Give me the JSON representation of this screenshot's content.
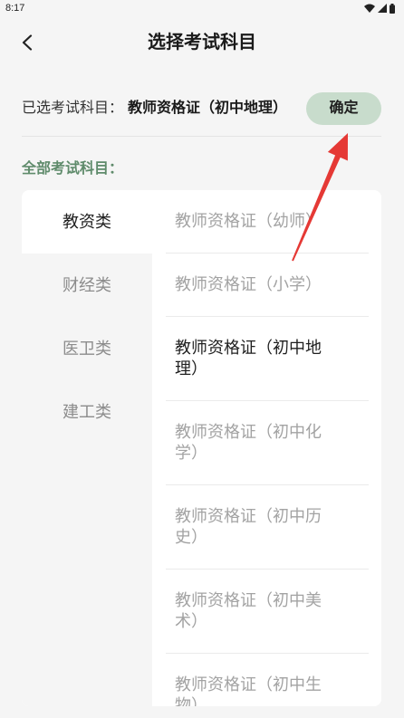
{
  "status_bar": {
    "time": "8:17",
    "icons": [
      "wifi-icon",
      "signal-icon",
      "battery-icon"
    ]
  },
  "header": {
    "back_icon": "chevron-left-icon",
    "title": "选择考试科目"
  },
  "selection": {
    "label": "已选考试科目：",
    "value": "教师资格证（初中地理）",
    "confirm_label": "确定"
  },
  "all_subjects": {
    "label": "全部考试科目："
  },
  "categories": [
    {
      "label": "教资类",
      "selected": true
    },
    {
      "label": "财经类",
      "selected": false
    },
    {
      "label": "医卫类",
      "selected": false
    },
    {
      "label": "建工类",
      "selected": false
    }
  ],
  "subjects": [
    {
      "label": "教师资格证（幼师）",
      "selected": false
    },
    {
      "label": "教师资格证（小学）",
      "selected": false
    },
    {
      "label": "教师资格证（初中地理）",
      "selected": true
    },
    {
      "label": "教师资格证（初中化学）",
      "selected": false
    },
    {
      "label": "教师资格证（初中历史）",
      "selected": false
    },
    {
      "label": "教师资格证（初中美术）",
      "selected": false
    },
    {
      "label": "教师资格证（初中生物）",
      "selected": false
    }
  ],
  "colors": {
    "background": "#f5f5f5",
    "card": "#ffffff",
    "accent": "#5f8b6b",
    "confirm_bg": "#c8dccc",
    "text": "#1f1f1f",
    "muted": "#a3a3a3",
    "cat_muted": "#8c8c8c",
    "annotation": "#e53935"
  }
}
